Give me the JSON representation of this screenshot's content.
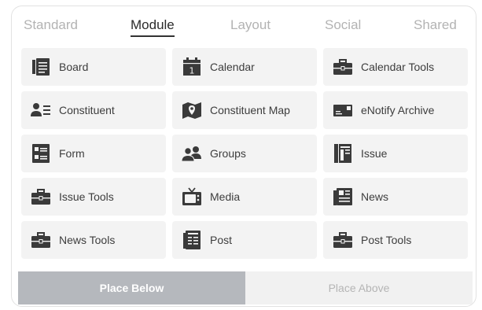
{
  "tabs": [
    {
      "label": "Standard",
      "active": false
    },
    {
      "label": "Module",
      "active": true
    },
    {
      "label": "Layout",
      "active": false
    },
    {
      "label": "Social",
      "active": false
    },
    {
      "label": "Shared",
      "active": false
    }
  ],
  "modules": [
    {
      "label": "Board",
      "icon": "board-icon"
    },
    {
      "label": "Calendar",
      "icon": "calendar-icon"
    },
    {
      "label": "Calendar Tools",
      "icon": "toolbox-icon"
    },
    {
      "label": "Constituent",
      "icon": "constituent-icon"
    },
    {
      "label": "Constituent Map",
      "icon": "map-icon"
    },
    {
      "label": "eNotify Archive",
      "icon": "enotify-icon"
    },
    {
      "label": "Form",
      "icon": "form-icon"
    },
    {
      "label": "Groups",
      "icon": "groups-icon"
    },
    {
      "label": "Issue",
      "icon": "issue-icon"
    },
    {
      "label": "Issue Tools",
      "icon": "toolbox-icon"
    },
    {
      "label": "Media",
      "icon": "media-icon"
    },
    {
      "label": "News",
      "icon": "news-icon"
    },
    {
      "label": "News Tools",
      "icon": "toolbox-icon"
    },
    {
      "label": "Post",
      "icon": "post-icon"
    },
    {
      "label": "Post Tools",
      "icon": "toolbox-icon"
    }
  ],
  "actions": {
    "place_below": "Place Below",
    "place_above": "Place Above"
  },
  "colors": {
    "icon": "#3a3a3a",
    "tile_bg": "#f3f3f3",
    "primary_button": "#b5b8bd",
    "secondary_button": "#f1f1f1"
  }
}
